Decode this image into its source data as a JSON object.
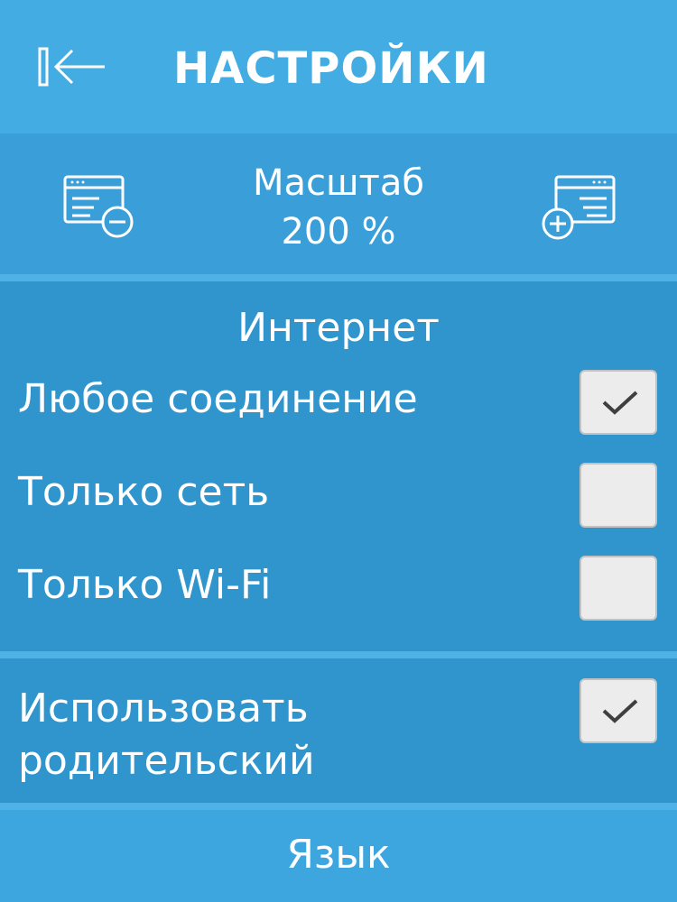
{
  "header": {
    "title": "НАСТРОЙКИ",
    "back_icon": "back-arrow-icon"
  },
  "zoom": {
    "label": "Масштаб",
    "value": "200 %",
    "zoom_out_icon": "zoom-out-icon",
    "zoom_in_icon": "zoom-in-icon"
  },
  "internet": {
    "title": "Интернет",
    "options": [
      {
        "label": "Любое соединение",
        "checked": true
      },
      {
        "label": "Только сеть",
        "checked": false
      },
      {
        "label": "Только Wi-Fi",
        "checked": false
      }
    ]
  },
  "parental": {
    "line1": "Использовать",
    "line2": "родительский",
    "checked": true
  },
  "language": {
    "title": "Язык"
  },
  "colors": {
    "header": "#43ade3",
    "background": "#2f95cc",
    "checkbox": "#ececec"
  }
}
